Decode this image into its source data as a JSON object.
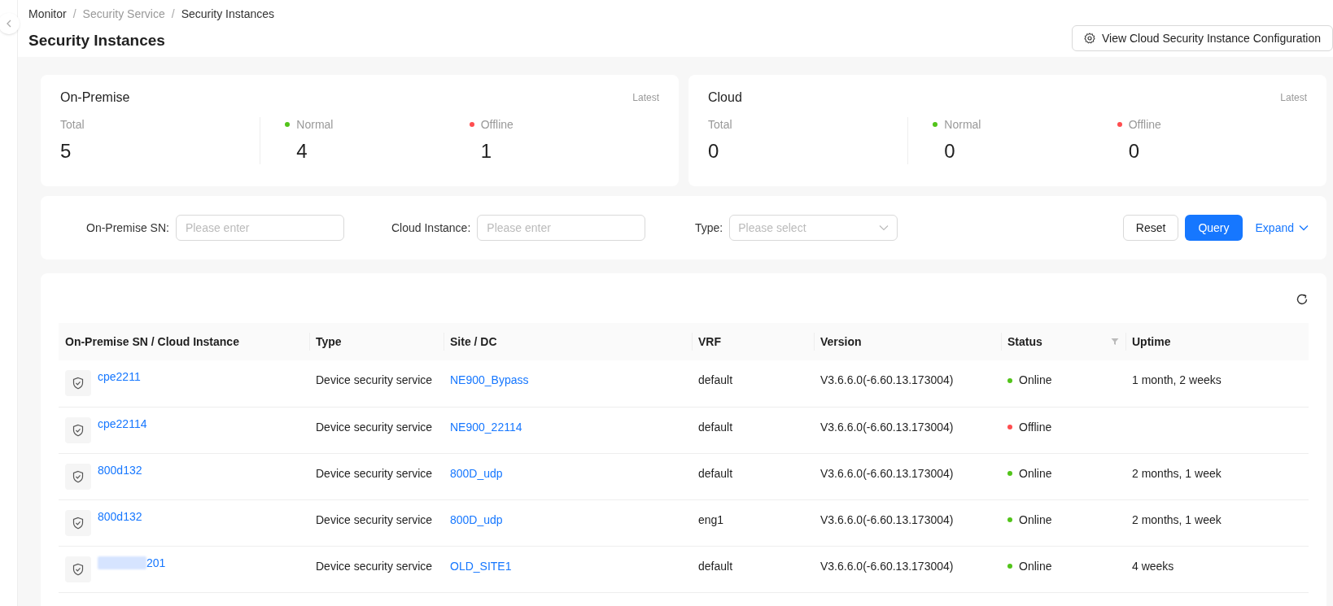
{
  "breadcrumb": [
    {
      "label": "Monitor",
      "muted": false
    },
    {
      "separator": "/",
      "label": "Security Service",
      "muted": true
    },
    {
      "separator": "/",
      "label": "Security Instances",
      "muted": false
    }
  ],
  "title": "Security Instances",
  "config_button": "View Cloud Security Instance Configuration",
  "summary_cards": [
    {
      "title": "On-Premise",
      "badge": "Latest",
      "stats": [
        {
          "label": "Total",
          "value": "5"
        },
        {
          "label": "Normal",
          "value": "4",
          "color": "#52c41a"
        },
        {
          "label": "Offline",
          "value": "1",
          "color": "#ff4d4f"
        }
      ]
    },
    {
      "title": "Cloud",
      "badge": "Latest",
      "stats": [
        {
          "label": "Total",
          "value": "0"
        },
        {
          "label": "Normal",
          "value": "0",
          "color": "#52c41a"
        },
        {
          "label": "Offline",
          "value": "0",
          "color": "#ff4d4f"
        }
      ]
    }
  ],
  "filters": [
    {
      "label": "On-Premise SN:",
      "kind": "input",
      "placeholder": "Please enter"
    },
    {
      "label": "Cloud Instance:",
      "kind": "input",
      "placeholder": "Please enter"
    },
    {
      "label": "Type:",
      "kind": "select",
      "placeholder": "Please select"
    }
  ],
  "filter_buttons": {
    "reset": "Reset",
    "query": "Query",
    "expand": "Expand"
  },
  "table": {
    "columns": [
      "On-Premise SN / Cloud Instance",
      "Type",
      "Site / DC",
      "VRF",
      "Version",
      "Status",
      "Uptime"
    ],
    "rows": [
      {
        "name": "cpe2211",
        "redacted": false,
        "type": "Device security service",
        "site": "NE900_Bypass",
        "vrf": "default",
        "version": "V3.6.6.0(-6.60.13.173004)",
        "status": "Online",
        "color": "#52c41a",
        "uptime": "1 month, 2 weeks"
      },
      {
        "name": "cpe22114",
        "redacted": false,
        "type": "Device security service",
        "site": "NE900_22114",
        "vrf": "default",
        "version": "V3.6.6.0(-6.60.13.173004)",
        "status": "Offline",
        "color": "#ff4d4f"
      },
      {
        "name": "800d132",
        "redacted": false,
        "type": "Device security service",
        "site": "800D_udp",
        "vrf": "default",
        "version": "V3.6.6.0(-6.60.13.173004)",
        "status": "Online",
        "color": "#52c41a",
        "uptime": "2 months, 1 week"
      },
      {
        "name": "800d132",
        "redacted": false,
        "type": "Device security service",
        "site": "800D_udp",
        "vrf": "eng1",
        "version": "V3.6.6.0(-6.60.13.173004)",
        "status": "Online",
        "color": "#52c41a",
        "uptime": "2 months, 1 week"
      },
      {
        "name": "201",
        "redacted": true,
        "type": "Device security service",
        "site": "OLD_SITE1",
        "vrf": "default",
        "version": "V3.6.6.0(-6.60.13.173004)",
        "status": "Online",
        "color": "#52c41a",
        "uptime": "4 weeks"
      }
    ]
  }
}
